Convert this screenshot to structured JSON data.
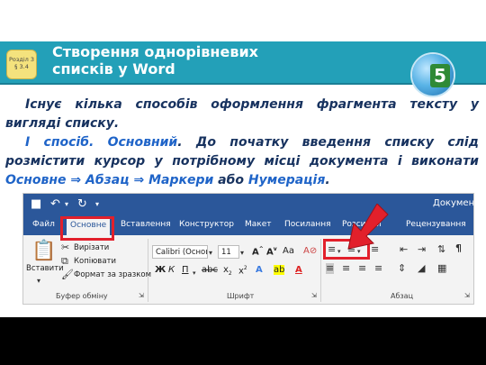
{
  "header": {
    "title_line1": "Створення однорівневих",
    "title_line2": "списків у Word",
    "badge_line1": "Розділ 3",
    "badge_line2": "§ 3.4",
    "grade_number": "5"
  },
  "text": {
    "p1": "Існує кілька способів оформлення фрагмента тексту у вигляді списку.",
    "p2_lead": "I спосіб. Основний",
    "p2_mid": ". До початку введення списку слід розмістити курсор у потрібному місці документа і виконати ",
    "kw1": "Основне",
    "arrow": "⇒",
    "kw2": "Абзац",
    "kw3": "Маркери",
    "conj": " або ",
    "kw4": "Нумерація",
    "end": "."
  },
  "word": {
    "doc_title": "Документ",
    "tabs": [
      "Файл",
      "Основне",
      "Вставлення",
      "Конструктор",
      "Макет",
      "Посилання",
      "Розсилки",
      "Рецензування"
    ],
    "clipboard": {
      "paste": "Вставити",
      "cut": "Вирізати",
      "copy": "Копіювати",
      "format_painter": "Формат за зразком",
      "label": "Буфер обміну"
    },
    "font": {
      "name": "Calibri (Основ",
      "size": "11",
      "label": "Шрифт"
    },
    "paragraph": {
      "label": "Абзац"
    },
    "colors": {
      "ribbon_blue": "#2b579a",
      "highlight_red": "#e2202b"
    }
  }
}
